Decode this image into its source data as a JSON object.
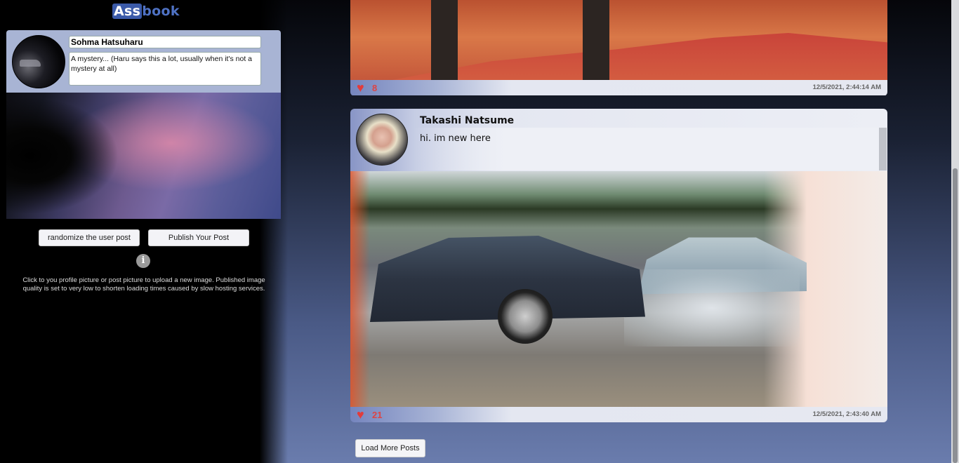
{
  "logo": {
    "part1": "Ass",
    "part2": "book"
  },
  "composer": {
    "name": "Sohma Hatsuharu",
    "text": "A mystery... (Haru says this a lot, usually when it's not a mystery at all)",
    "randomize_label": "randomize the user post",
    "publish_label": "Publish Your Post",
    "info_icon": "i",
    "info_text": "Click to you profile picture or post picture to upload a new image. Published image quality is set to very low to shorten loading times caused by slow hosting services."
  },
  "posts": [
    {
      "likes": "8",
      "timestamp": "12/5/2021, 2:44:14 AM"
    },
    {
      "author": "Takashi Natsume",
      "text": "hi. im new here",
      "likes": "21",
      "timestamp": "12/5/2021, 2:43:40 AM"
    }
  ],
  "feed": {
    "load_more_label": "Load More Posts"
  },
  "icons": {
    "heart": "heart-icon",
    "info": "info-icon"
  },
  "colors": {
    "accent": "#3b5aa8",
    "heart": "#e23b3b"
  }
}
